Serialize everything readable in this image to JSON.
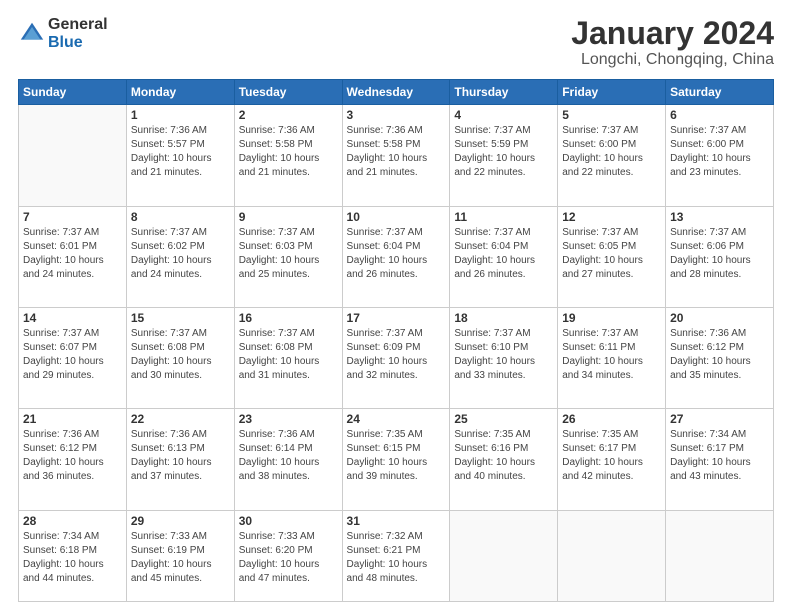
{
  "logo": {
    "general": "General",
    "blue": "Blue"
  },
  "title": "January 2024",
  "location": "Longchi, Chongqing, China",
  "weekdays": [
    "Sunday",
    "Monday",
    "Tuesday",
    "Wednesday",
    "Thursday",
    "Friday",
    "Saturday"
  ],
  "weeks": [
    [
      {
        "day": "",
        "info": ""
      },
      {
        "day": "1",
        "info": "Sunrise: 7:36 AM\nSunset: 5:57 PM\nDaylight: 10 hours\nand 21 minutes."
      },
      {
        "day": "2",
        "info": "Sunrise: 7:36 AM\nSunset: 5:58 PM\nDaylight: 10 hours\nand 21 minutes."
      },
      {
        "day": "3",
        "info": "Sunrise: 7:36 AM\nSunset: 5:58 PM\nDaylight: 10 hours\nand 21 minutes."
      },
      {
        "day": "4",
        "info": "Sunrise: 7:37 AM\nSunset: 5:59 PM\nDaylight: 10 hours\nand 22 minutes."
      },
      {
        "day": "5",
        "info": "Sunrise: 7:37 AM\nSunset: 6:00 PM\nDaylight: 10 hours\nand 22 minutes."
      },
      {
        "day": "6",
        "info": "Sunrise: 7:37 AM\nSunset: 6:00 PM\nDaylight: 10 hours\nand 23 minutes."
      }
    ],
    [
      {
        "day": "7",
        "info": "Sunrise: 7:37 AM\nSunset: 6:01 PM\nDaylight: 10 hours\nand 24 minutes."
      },
      {
        "day": "8",
        "info": "Sunrise: 7:37 AM\nSunset: 6:02 PM\nDaylight: 10 hours\nand 24 minutes."
      },
      {
        "day": "9",
        "info": "Sunrise: 7:37 AM\nSunset: 6:03 PM\nDaylight: 10 hours\nand 25 minutes."
      },
      {
        "day": "10",
        "info": "Sunrise: 7:37 AM\nSunset: 6:04 PM\nDaylight: 10 hours\nand 26 minutes."
      },
      {
        "day": "11",
        "info": "Sunrise: 7:37 AM\nSunset: 6:04 PM\nDaylight: 10 hours\nand 26 minutes."
      },
      {
        "day": "12",
        "info": "Sunrise: 7:37 AM\nSunset: 6:05 PM\nDaylight: 10 hours\nand 27 minutes."
      },
      {
        "day": "13",
        "info": "Sunrise: 7:37 AM\nSunset: 6:06 PM\nDaylight: 10 hours\nand 28 minutes."
      }
    ],
    [
      {
        "day": "14",
        "info": "Sunrise: 7:37 AM\nSunset: 6:07 PM\nDaylight: 10 hours\nand 29 minutes."
      },
      {
        "day": "15",
        "info": "Sunrise: 7:37 AM\nSunset: 6:08 PM\nDaylight: 10 hours\nand 30 minutes."
      },
      {
        "day": "16",
        "info": "Sunrise: 7:37 AM\nSunset: 6:08 PM\nDaylight: 10 hours\nand 31 minutes."
      },
      {
        "day": "17",
        "info": "Sunrise: 7:37 AM\nSunset: 6:09 PM\nDaylight: 10 hours\nand 32 minutes."
      },
      {
        "day": "18",
        "info": "Sunrise: 7:37 AM\nSunset: 6:10 PM\nDaylight: 10 hours\nand 33 minutes."
      },
      {
        "day": "19",
        "info": "Sunrise: 7:37 AM\nSunset: 6:11 PM\nDaylight: 10 hours\nand 34 minutes."
      },
      {
        "day": "20",
        "info": "Sunrise: 7:36 AM\nSunset: 6:12 PM\nDaylight: 10 hours\nand 35 minutes."
      }
    ],
    [
      {
        "day": "21",
        "info": "Sunrise: 7:36 AM\nSunset: 6:12 PM\nDaylight: 10 hours\nand 36 minutes."
      },
      {
        "day": "22",
        "info": "Sunrise: 7:36 AM\nSunset: 6:13 PM\nDaylight: 10 hours\nand 37 minutes."
      },
      {
        "day": "23",
        "info": "Sunrise: 7:36 AM\nSunset: 6:14 PM\nDaylight: 10 hours\nand 38 minutes."
      },
      {
        "day": "24",
        "info": "Sunrise: 7:35 AM\nSunset: 6:15 PM\nDaylight: 10 hours\nand 39 minutes."
      },
      {
        "day": "25",
        "info": "Sunrise: 7:35 AM\nSunset: 6:16 PM\nDaylight: 10 hours\nand 40 minutes."
      },
      {
        "day": "26",
        "info": "Sunrise: 7:35 AM\nSunset: 6:17 PM\nDaylight: 10 hours\nand 42 minutes."
      },
      {
        "day": "27",
        "info": "Sunrise: 7:34 AM\nSunset: 6:17 PM\nDaylight: 10 hours\nand 43 minutes."
      }
    ],
    [
      {
        "day": "28",
        "info": "Sunrise: 7:34 AM\nSunset: 6:18 PM\nDaylight: 10 hours\nand 44 minutes."
      },
      {
        "day": "29",
        "info": "Sunrise: 7:33 AM\nSunset: 6:19 PM\nDaylight: 10 hours\nand 45 minutes."
      },
      {
        "day": "30",
        "info": "Sunrise: 7:33 AM\nSunset: 6:20 PM\nDaylight: 10 hours\nand 47 minutes."
      },
      {
        "day": "31",
        "info": "Sunrise: 7:32 AM\nSunset: 6:21 PM\nDaylight: 10 hours\nand 48 minutes."
      },
      {
        "day": "",
        "info": ""
      },
      {
        "day": "",
        "info": ""
      },
      {
        "day": "",
        "info": ""
      }
    ]
  ]
}
